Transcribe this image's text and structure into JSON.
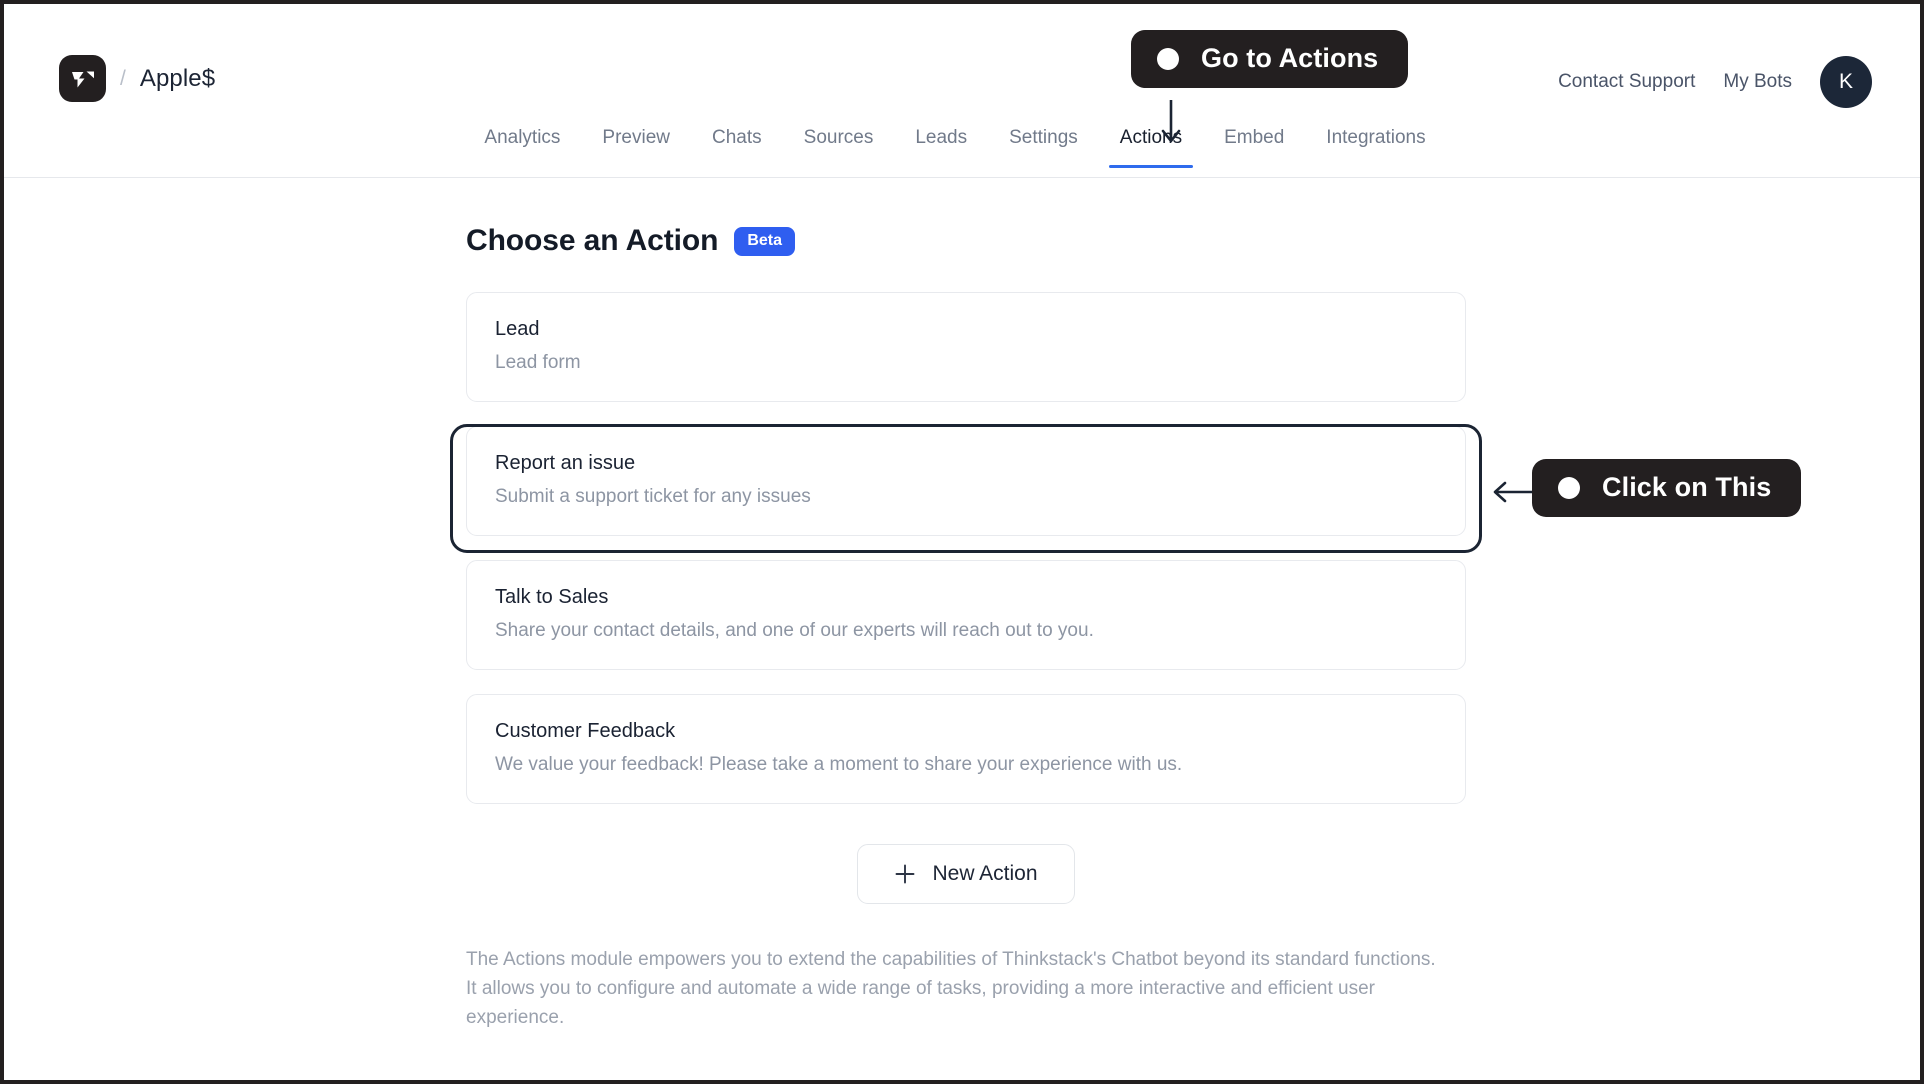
{
  "header": {
    "logo_icon": "thinkstack-logo-icon",
    "separator": "/",
    "bot_name": "Apple$",
    "contact_support": "Contact Support",
    "my_bots": "My Bots",
    "avatar_initial": "K"
  },
  "tabs": [
    {
      "label": "Analytics",
      "active": false
    },
    {
      "label": "Preview",
      "active": false
    },
    {
      "label": "Chats",
      "active": false
    },
    {
      "label": "Sources",
      "active": false
    },
    {
      "label": "Leads",
      "active": false
    },
    {
      "label": "Settings",
      "active": false
    },
    {
      "label": "Actions",
      "active": true
    },
    {
      "label": "Embed",
      "active": false
    },
    {
      "label": "Integrations",
      "active": false
    }
  ],
  "main": {
    "title": "Choose an Action",
    "badge": "Beta",
    "cards": [
      {
        "title": "Lead",
        "desc": "Lead form"
      },
      {
        "title": "Report an issue",
        "desc": "Submit a support ticket for any issues"
      },
      {
        "title": "Talk to Sales",
        "desc": "Share your contact details, and one of our experts will reach out to you."
      },
      {
        "title": "Customer Feedback",
        "desc": "We value your feedback! Please take a moment to share your experience with us."
      }
    ],
    "new_action_label": "New Action",
    "plus_icon": "plus-icon",
    "footnote": "The Actions module empowers you to extend the capabilities of Thinkstack's Chatbot beyond its standard functions. It allows you to configure and automate a wide range of tasks, providing a more interactive and efficient user experience."
  },
  "annotations": [
    {
      "text": "Go to Actions",
      "target": "tab-actions"
    },
    {
      "text": "Click on This",
      "target": "card-report-an-issue"
    }
  ],
  "colors": {
    "accent_blue": "#2f5ef0",
    "tab_underline": "#2f6bed",
    "annotation_dark": "#231f20",
    "arrow_navy": "#1b2433"
  }
}
